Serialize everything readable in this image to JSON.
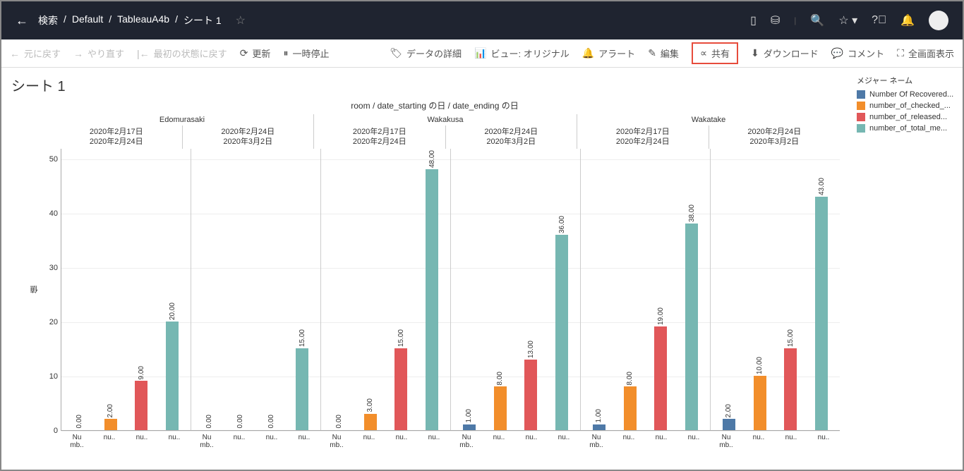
{
  "header": {
    "breadcrumb": [
      "検索",
      "Default",
      "TableauA4b",
      "シート 1"
    ]
  },
  "toolbar": {
    "undo": "元に戻す",
    "redo": "やり直す",
    "revert": "最初の状態に戻す",
    "refresh": "更新",
    "pause": "一時停止",
    "data_details": "データの詳細",
    "view": "ビュー: オリジナル",
    "alert": "アラート",
    "edit": "編集",
    "share": "共有",
    "download": "ダウンロード",
    "comment": "コメント",
    "fullscreen": "全画面表示"
  },
  "sheet_title": "シート 1",
  "legend": {
    "title": "メジャー ネーム",
    "items": [
      {
        "color": "#4e79a7",
        "label": "Number Of Recovered..."
      },
      {
        "color": "#f28e2b",
        "label": "number_of_checked_..."
      },
      {
        "color": "#e15759",
        "label": "number_of_released..."
      },
      {
        "color": "#76b7b2",
        "label": "number_of_total_me..."
      }
    ]
  },
  "chart_data": {
    "type": "bar",
    "title": "room / date_starting の日 / date_ending の日",
    "ylabel": "値",
    "ylim": [
      0,
      52
    ],
    "yticks": [
      0,
      10,
      20,
      30,
      40,
      50
    ],
    "rooms": [
      "Edomurasaki",
      "Wakakusa",
      "Wakatake"
    ],
    "date_pairs": [
      {
        "start": "2020年2月17日",
        "end": "2020年2月24日"
      },
      {
        "start": "2020年2月24日",
        "end": "2020年3月2日"
      }
    ],
    "measures_short": [
      "Nu\nmb..",
      "nu..",
      "nu..",
      "nu.."
    ],
    "colors": [
      "#4e79a7",
      "#f28e2b",
      "#e15759",
      "#76b7b2"
    ],
    "panels": [
      {
        "room": "Edomurasaki",
        "pair": 0,
        "values": [
          0,
          2,
          9,
          20
        ]
      },
      {
        "room": "Edomurasaki",
        "pair": 1,
        "values": [
          0,
          0,
          0,
          15
        ]
      },
      {
        "room": "Wakakusa",
        "pair": 0,
        "values": [
          0,
          3,
          15,
          48
        ]
      },
      {
        "room": "Wakakusa",
        "pair": 1,
        "values": [
          1,
          8,
          13,
          36
        ]
      },
      {
        "room": "Wakatake",
        "pair": 0,
        "values": [
          1,
          8,
          19,
          38
        ]
      },
      {
        "room": "Wakatake",
        "pair": 1,
        "values": [
          2,
          10,
          15,
          43
        ]
      }
    ]
  }
}
